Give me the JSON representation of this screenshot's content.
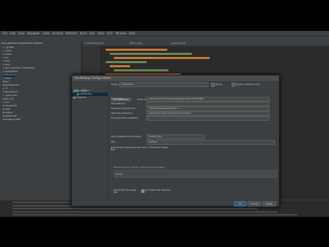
{
  "menu": {
    "items": [
      "File",
      "Edit",
      "View",
      "Navigate",
      "Code",
      "Analyze",
      "Refactor",
      "Build",
      "Run",
      "Tools",
      "VCS",
      "Window",
      "Help"
    ]
  },
  "project": {
    "root": "java-selenium-framework (Firefox)",
    "items": [
      "> .gradle",
      "> .idea",
      "> build",
      "v src",
      "  v test",
      "    v java",
      "      v com.selenium.framework",
      "        v Application",
      "          FirefoxTest",
      "        > base",
      "          Base",
      "          BaseListeners",
      "        v TC",
      "          FirefoxTestTC",
      "  > resources",
      "      log4j.xml",
      "> out",
      "  build.gradle",
      "  gradle",
      "  gradlew",
      "  gradlew.bat",
      "  settings.gradle"
    ]
  },
  "dialog": {
    "title": "Run/Debug Configurations",
    "left_items": [
      "Application",
      "FirefoxTest",
      "Defaults"
    ],
    "name_label": "Name:",
    "name_value": "FirefoxTest",
    "share_label": "Share",
    "single_instance_label": "Single instance only",
    "tabs": [
      "Configuration",
      "Code Coverage",
      "Logs"
    ],
    "fields": [
      {
        "label": "Main class:",
        "value": "com.selenium.framework.Application.FirefoxTest"
      },
      {
        "label": "VM options:",
        "value": ""
      },
      {
        "label": "Program arguments:",
        "value": "-Dwebdriver.gecko.driver=..."
      },
      {
        "label": "Working directory:",
        "value": "/home/user/java-selenium-framework"
      },
      {
        "label": "Environment variables:",
        "value": ""
      }
    ],
    "module_label": "Use classpath of module:",
    "module_value": "Firefox_test",
    "jre_label": "JRE:",
    "jre_value": "Default",
    "provided_scope": "Include dependencies with \"Provided\" scope",
    "before_launch": "Before launch: Build, Activate tool window",
    "build_item": "Build",
    "show_page": "Show this page",
    "activate_window": "Activate tool window",
    "ok": "OK",
    "cancel": "Cancel",
    "apply": "Apply"
  }
}
